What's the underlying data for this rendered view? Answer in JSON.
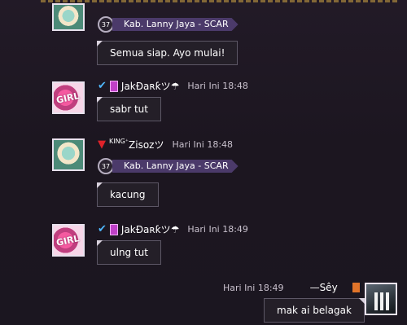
{
  "messages": [
    {
      "guild": "Kab. Lanny Jaya - SCAR",
      "level": "37",
      "text": "Semua siap. Ayo mulai!"
    },
    {
      "name": "JakĐaʀƙツ☂",
      "time": "Hari Ini 18:48",
      "text": "sabr tut"
    },
    {
      "name_prefix": "KING⁺",
      "name": "Zisozツ",
      "time": "Hari Ini 18:48",
      "level": "37",
      "guild": "Kab. Lanny Jaya - SCAR",
      "text": "kacung"
    },
    {
      "name": "JakĐaʀƙツ☂",
      "time": "Hari Ini 18:49",
      "text": "ulng tut"
    },
    {
      "name": "—Sêy",
      "time": "Hari Ini 18:49",
      "text": "mak ai belagak"
    }
  ],
  "avatar_labels": {
    "girl": "GIRL"
  }
}
